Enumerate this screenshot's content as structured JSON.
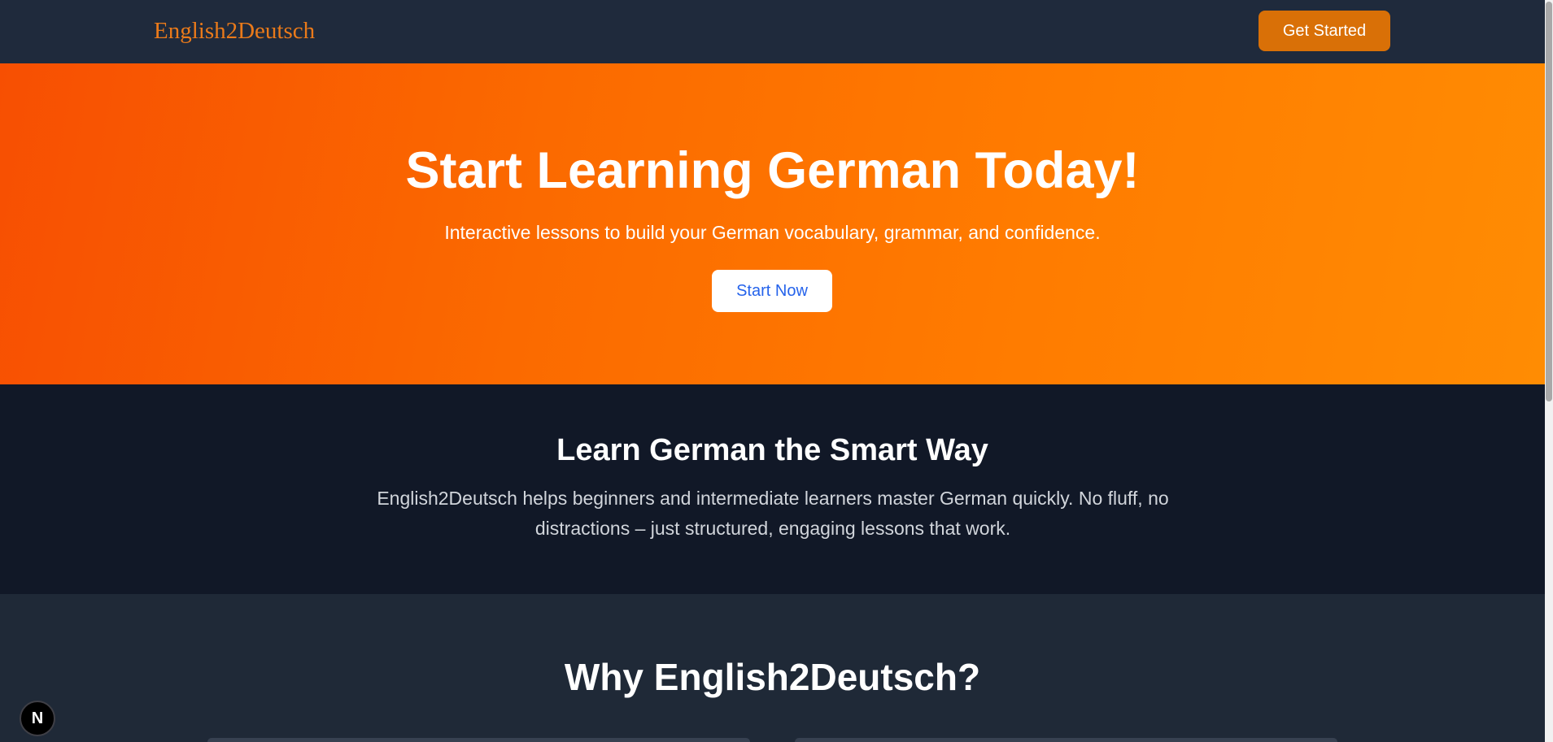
{
  "navbar": {
    "logo": "English2Deutsch",
    "cta_label": "Get Started"
  },
  "hero": {
    "title": "Start Learning German Today!",
    "subtitle": "Interactive lessons to build your German vocabulary, grammar, and confidence.",
    "button_label": "Start Now"
  },
  "about": {
    "title": "Learn German the Smart Way",
    "text": "English2Deutsch helps beginners and intermediate learners master German quickly. No fluff, no distractions – just structured, engaging lessons that work."
  },
  "why": {
    "title": "Why English2Deutsch?"
  },
  "dev_badge": {
    "label": "N"
  },
  "colors": {
    "navbar_bg": "#1f2a3c",
    "brand_orange": "#ea7a1a",
    "cta_bg": "#d97007",
    "hero_gradient_start": "#f74f02",
    "hero_gradient_end": "#ff8c03",
    "start_now_text": "#2563eb",
    "section_dark": "#111827",
    "section_gray": "#1f2937"
  },
  "icons": {
    "dev_badge": "nextjs-logo-icon"
  }
}
